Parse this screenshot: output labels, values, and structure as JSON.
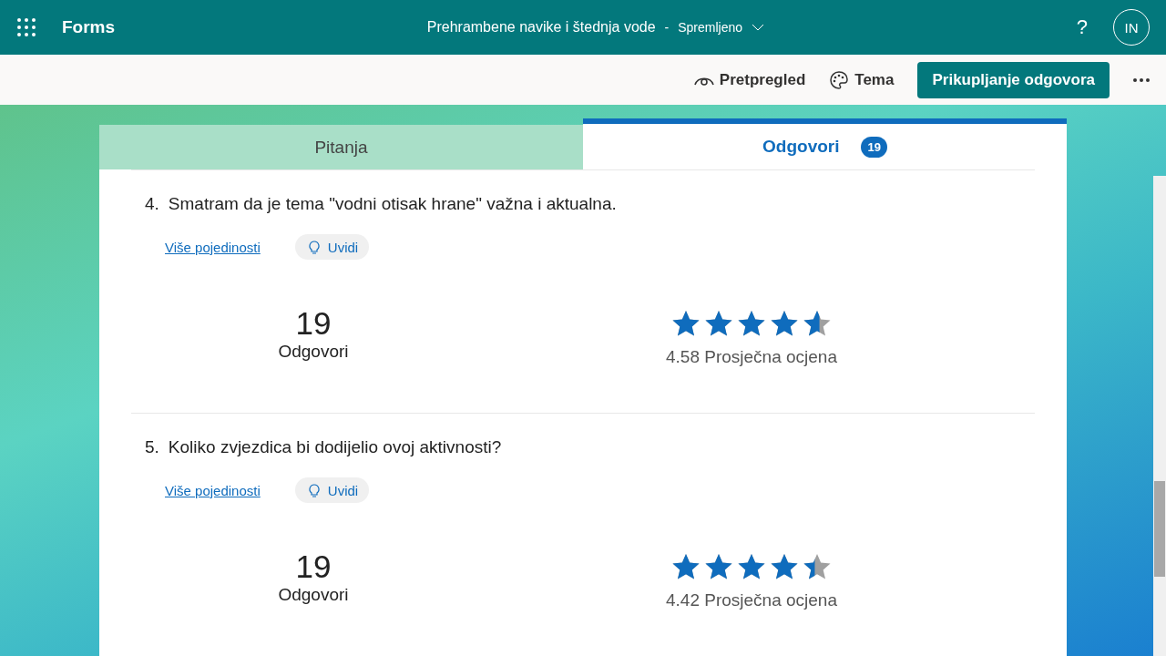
{
  "app": {
    "name": "Forms"
  },
  "header": {
    "form_title": "Prehrambene navike i štednja vode",
    "separator": "-",
    "save_status": "Spremljeno",
    "help": "?",
    "avatar_initials": "IN"
  },
  "toolbar": {
    "preview": "Pretpregled",
    "theme": "Tema",
    "collect": "Prikupljanje odgovora"
  },
  "tabs": [
    {
      "label": "Pitanja",
      "selected": false
    },
    {
      "label": "Odgovori",
      "selected": true,
      "count": "19"
    }
  ],
  "questions": [
    {
      "number": "4.",
      "text": "Smatram da je tema \"vodni otisak hrane\" važna i aktualna.",
      "details_link": "Više pojedinosti",
      "insights": "Uvidi",
      "responses_count": "19",
      "responses_label": "Odgovori",
      "stars": 4.58,
      "average": "4.58 Prosječna ocjena"
    },
    {
      "number": "5.",
      "text": "Koliko zvjezdica bi dodijelio ovoj aktivnosti?",
      "details_link": "Više pojedinosti",
      "insights": "Uvidi",
      "responses_count": "19",
      "responses_label": "Odgovori",
      "stars": 4.42,
      "average": "4.42 Prosječna ocjena"
    }
  ]
}
